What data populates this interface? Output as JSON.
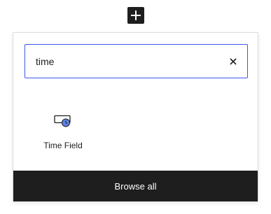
{
  "toolbar": {
    "add_icon": "plus-icon"
  },
  "search": {
    "value": "time",
    "clear_icon": "close-icon"
  },
  "results": [
    {
      "label": "Time Field",
      "icon": "time-field-icon"
    }
  ],
  "footer": {
    "browse_all_label": "Browse all"
  },
  "colors": {
    "accent": "#3858e9",
    "dark": "#1e1e1e"
  }
}
